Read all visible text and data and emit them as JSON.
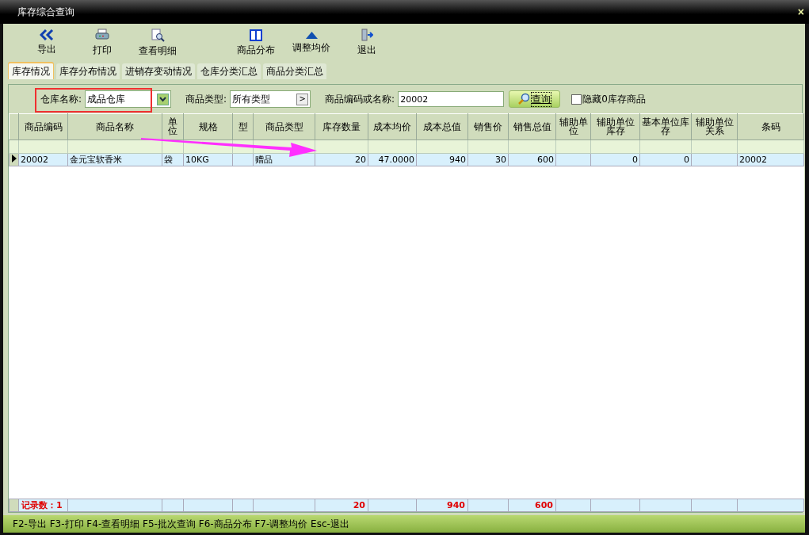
{
  "window": {
    "title": "库存综合查询",
    "close_glyph": "×"
  },
  "toolbar": [
    {
      "label": "导出"
    },
    {
      "label": "打印"
    },
    {
      "label": "查看明细"
    },
    {
      "label": "商品分布"
    },
    {
      "label": "调整均价"
    },
    {
      "label": "退出"
    }
  ],
  "tabs": [
    {
      "label": "库存情况",
      "selected": true
    },
    {
      "label": "库存分布情况",
      "selected": false
    },
    {
      "label": "进销存变动情况",
      "selected": false
    },
    {
      "label": "仓库分类汇总",
      "selected": false
    },
    {
      "label": "商品分类汇总",
      "selected": false
    }
  ],
  "filters": {
    "warehouse": {
      "label": "仓库名称:",
      "value": "成品仓库"
    },
    "type": {
      "label": "商品类型:",
      "value": "所有类型",
      "button_glyph": ">"
    },
    "code": {
      "label": "商品编码或名称:",
      "value": "20002"
    },
    "query_button": "查询",
    "hide_zero": {
      "label": "隐藏0库存商品",
      "checked": false
    }
  },
  "table": {
    "columns": [
      {
        "label": "商品编码"
      },
      {
        "label": "商品名称"
      },
      {
        "label": "单位"
      },
      {
        "label": "规格"
      },
      {
        "label": "型"
      },
      {
        "label": "商品类型"
      },
      {
        "label": "库存数量",
        "total": "20"
      },
      {
        "label": "成本均价"
      },
      {
        "label": "成本总值",
        "total": "940"
      },
      {
        "label": "销售价"
      },
      {
        "label": "销售总值",
        "total": "600"
      },
      {
        "label": "辅助单位"
      },
      {
        "label": "辅助单位库存"
      },
      {
        "label": "基本单位库存"
      },
      {
        "label": "辅助单位关系"
      },
      {
        "label": "条码"
      }
    ],
    "rows": [
      {
        "selected": true,
        "cells": [
          "20002",
          "金元宝软香米",
          "袋",
          "10KG",
          null,
          "赠品",
          "20",
          "47.0000",
          "940",
          "30",
          "600",
          null,
          "0",
          "0",
          null,
          "20002"
        ]
      }
    ],
    "record_count": "记录数：1"
  },
  "status_bar": "F2-导出 F3-打印 F4-查看明细 F5-批次查询 F6-商品分布 F7-调整均价 Esc-退出"
}
